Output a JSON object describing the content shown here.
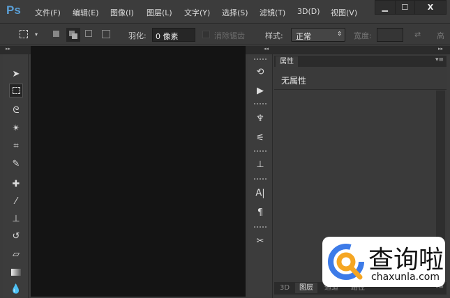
{
  "app": {
    "logo": "Ps"
  },
  "menu": [
    "文件(F)",
    "编辑(E)",
    "图像(I)",
    "图层(L)",
    "文字(Y)",
    "选择(S)",
    "滤镜(T)",
    "3D(D)",
    "视图(V)"
  ],
  "window_controls": {
    "minimize": "▁",
    "maximize": "☐",
    "close": "X"
  },
  "options": {
    "feather_label": "羽化:",
    "feather_value": "0 像素",
    "antialias_label": "消除锯齿",
    "style_label": "样式:",
    "style_value": "正常",
    "width_label": "宽度:",
    "height_label": "高"
  },
  "panel": {
    "tab": "属性",
    "content": "无属性",
    "bottom_tabs": [
      "3D",
      "图层",
      "通道",
      "路径"
    ]
  },
  "watermark": {
    "text": "查询啦",
    "url": "chaxunla.com",
    "colors": {
      "blue": "#3d7be8",
      "orange": "#f5a623"
    }
  }
}
